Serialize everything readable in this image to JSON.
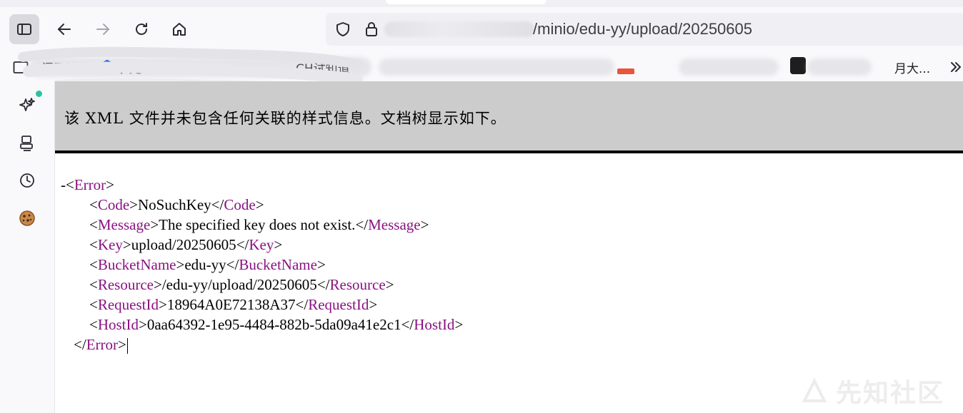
{
  "browser": {
    "url_visible": "/minio/edu-yy/upload/20250605",
    "bookmarks": {
      "item1": "门网址",
      "item2": "文心一",
      "item3": "CH试知道",
      "item4": "月大..."
    }
  },
  "content": {
    "header_text": "该 XML 文件并未包含任何关联的样式信息。文档树显示如下。",
    "fold_marker": "-",
    "root_tag": "Error",
    "children": [
      {
        "tag": "Code",
        "value": "NoSuchKey"
      },
      {
        "tag": "Message",
        "value": "The specified key does not exist."
      },
      {
        "tag": "Key",
        "value": "upload/20250605"
      },
      {
        "tag": "BucketName",
        "value": "edu-yy"
      },
      {
        "tag": "Resource",
        "value": "/edu-yy/upload/20250605"
      },
      {
        "tag": "RequestId",
        "value": "18964A0E72138A37"
      },
      {
        "tag": "HostId",
        "value": "0aa64392-1e95-4484-882b-5da09a41e2c1"
      }
    ]
  },
  "watermark": "先知社区",
  "colors": {
    "tag": "#881280",
    "header_bg": "#cccccc",
    "toolbar_bg": "#f9f9fb",
    "status_dot": "#2ac3a2"
  }
}
